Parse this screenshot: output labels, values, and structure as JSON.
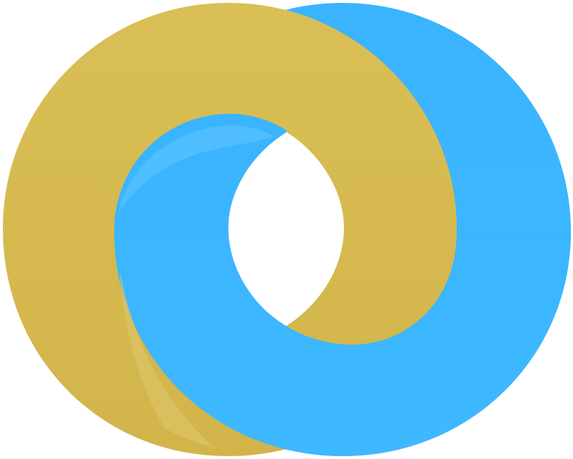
{
  "logo": {
    "icon": "interlocking-rings-logo-icon",
    "colors": {
      "gold_ring": "#D9BF55",
      "gold_ring_dark": "#D2B44A",
      "gold_ring_light": "#DEC66A",
      "blue_ring": "#3AB4FF",
      "blue_ring_dark": "#3EB8FF",
      "blue_ring_light": "#63C5FF",
      "background": "#FFFFFF"
    }
  }
}
